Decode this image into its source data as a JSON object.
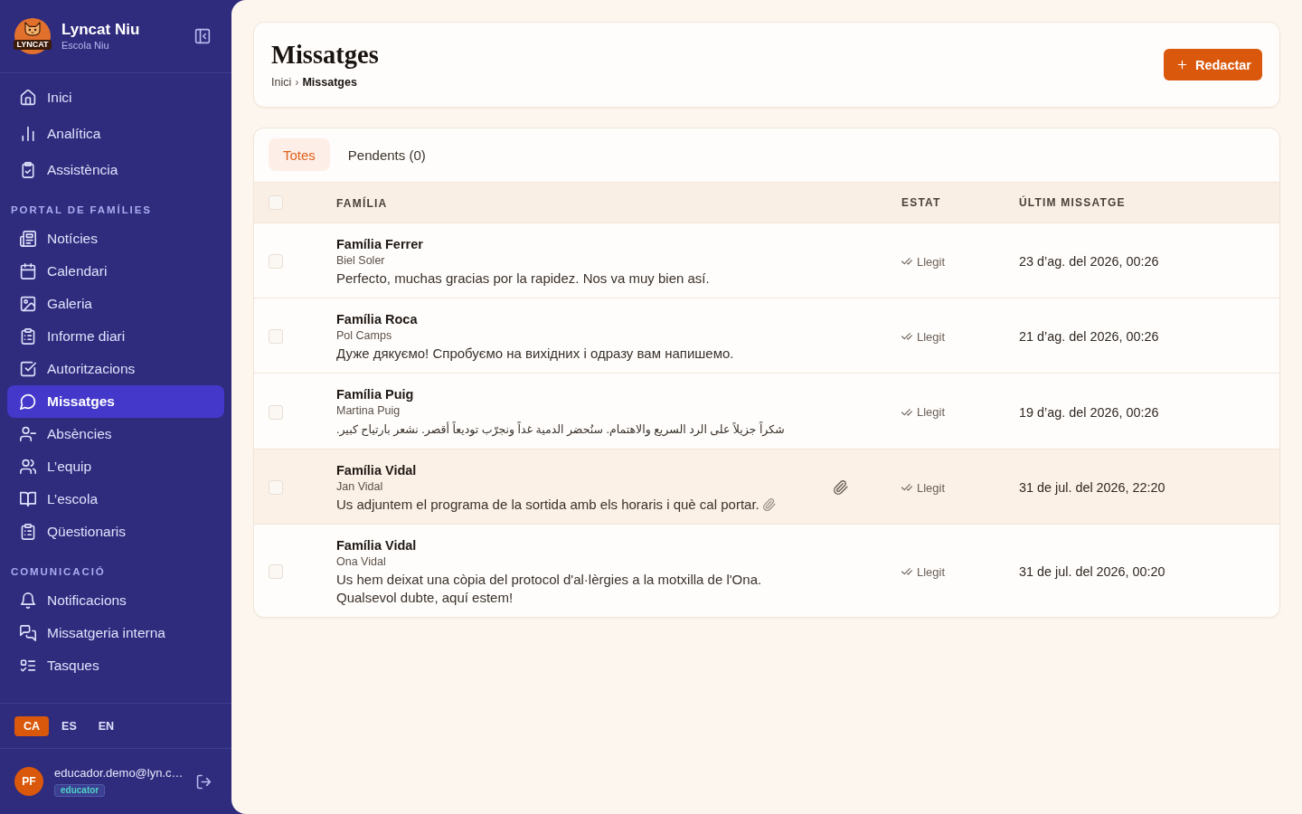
{
  "sidebar": {
    "logo_text": "LYNCAT",
    "brand": "Lyncat Niu",
    "school": "Escola Niu",
    "sections": [
      {
        "items": [
          {
            "label": "Inici",
            "selected": false
          },
          {
            "label": "Analítica",
            "selected": false
          },
          {
            "label": "Assistència",
            "selected": false
          }
        ]
      },
      {
        "title": "PORTAL DE FAMÍLIES",
        "items": [
          {
            "label": "Notícies",
            "selected": false
          },
          {
            "label": "Calendari",
            "selected": false
          },
          {
            "label": "Galeria",
            "selected": false
          },
          {
            "label": "Informe diari",
            "selected": false
          },
          {
            "label": "Autoritzacions",
            "selected": false
          },
          {
            "label": "Missatges",
            "selected": true
          },
          {
            "label": "Absències",
            "selected": false
          },
          {
            "label": "L’equip",
            "selected": false
          },
          {
            "label": "L’escola",
            "selected": false
          },
          {
            "label": "Qüestionaris",
            "selected": false
          }
        ]
      },
      {
        "title": "COMUNICACIÓ",
        "items": [
          {
            "label": "Notificacions",
            "selected": false
          },
          {
            "label": "Missatgeria interna",
            "selected": false
          },
          {
            "label": "Tasques",
            "selected": false
          }
        ]
      }
    ],
    "languages": [
      {
        "label": "CA",
        "selected": true
      },
      {
        "label": "ES",
        "selected": false
      },
      {
        "label": "EN",
        "selected": false
      }
    ],
    "user": {
      "initials": "PF",
      "email": "educador.demo@lyn.c…",
      "role": "educator"
    }
  },
  "header": {
    "title": "Missatges",
    "breadcrumb": [
      {
        "label": "Inici",
        "current": false
      },
      {
        "label": "Missatges",
        "current": true
      }
    ],
    "breadcrumb_separator": "›",
    "compose_button": "Redactar"
  },
  "tabs": [
    {
      "label": "Totes",
      "selected": true
    },
    {
      "label": "Pendents (0)",
      "selected": false
    }
  ],
  "table": {
    "select_all_checked": false,
    "columns": [
      "FAMÍLIA",
      "ESTAT",
      "ÚLTIM MISSATGE"
    ],
    "rows": [
      {
        "family": "Família Ferrer",
        "contact": "Biel Soler",
        "message": "Perfecto, muchas gracias por la rapidez. Nos va muy bien así.",
        "message_clip": false,
        "attachment": false,
        "status": "Llegit",
        "date": "23 d’ag. del 2026, 00:26",
        "checked": false,
        "hovered": false
      },
      {
        "family": "Família Roca",
        "contact": "Pol Camps",
        "message": "Дуже дякуємо! Спробуємо на вихідних і одразу вам напишемо.",
        "message_clip": false,
        "attachment": false,
        "status": "Llegit",
        "date": "21 d’ag. del 2026, 00:26",
        "checked": false,
        "hovered": false
      },
      {
        "family": "Família Puig",
        "contact": "Martina Puig",
        "message": "شكراً جزيلاً على الرد السريع والاهتمام. سنُحضر الدمية غداً ونجرّب توديعاً أقصر. نشعر بارتياح كبير.",
        "message_clip": false,
        "attachment": false,
        "status": "Llegit",
        "date": "19 d’ag. del 2026, 00:26",
        "checked": false,
        "hovered": false
      },
      {
        "family": "Família Vidal",
        "contact": "Jan Vidal",
        "message": "Us adjuntem el programa de la sortida amb els horaris i què cal portar.",
        "message_clip": true,
        "attachment": true,
        "status": "Llegit",
        "date": "31 de jul. del 2026, 22:20",
        "checked": false,
        "hovered": true
      },
      {
        "family": "Família Vidal",
        "contact": "Ona Vidal",
        "message": "Us hem deixat una còpia del protocol d'al·lèrgies a la motxilla de l'Ona. Qualsevol dubte, aquí estem!",
        "message_clip": false,
        "attachment": false,
        "status": "Llegit",
        "date": "31 de jul. del 2026, 00:20",
        "checked": false,
        "hovered": false
      }
    ]
  }
}
